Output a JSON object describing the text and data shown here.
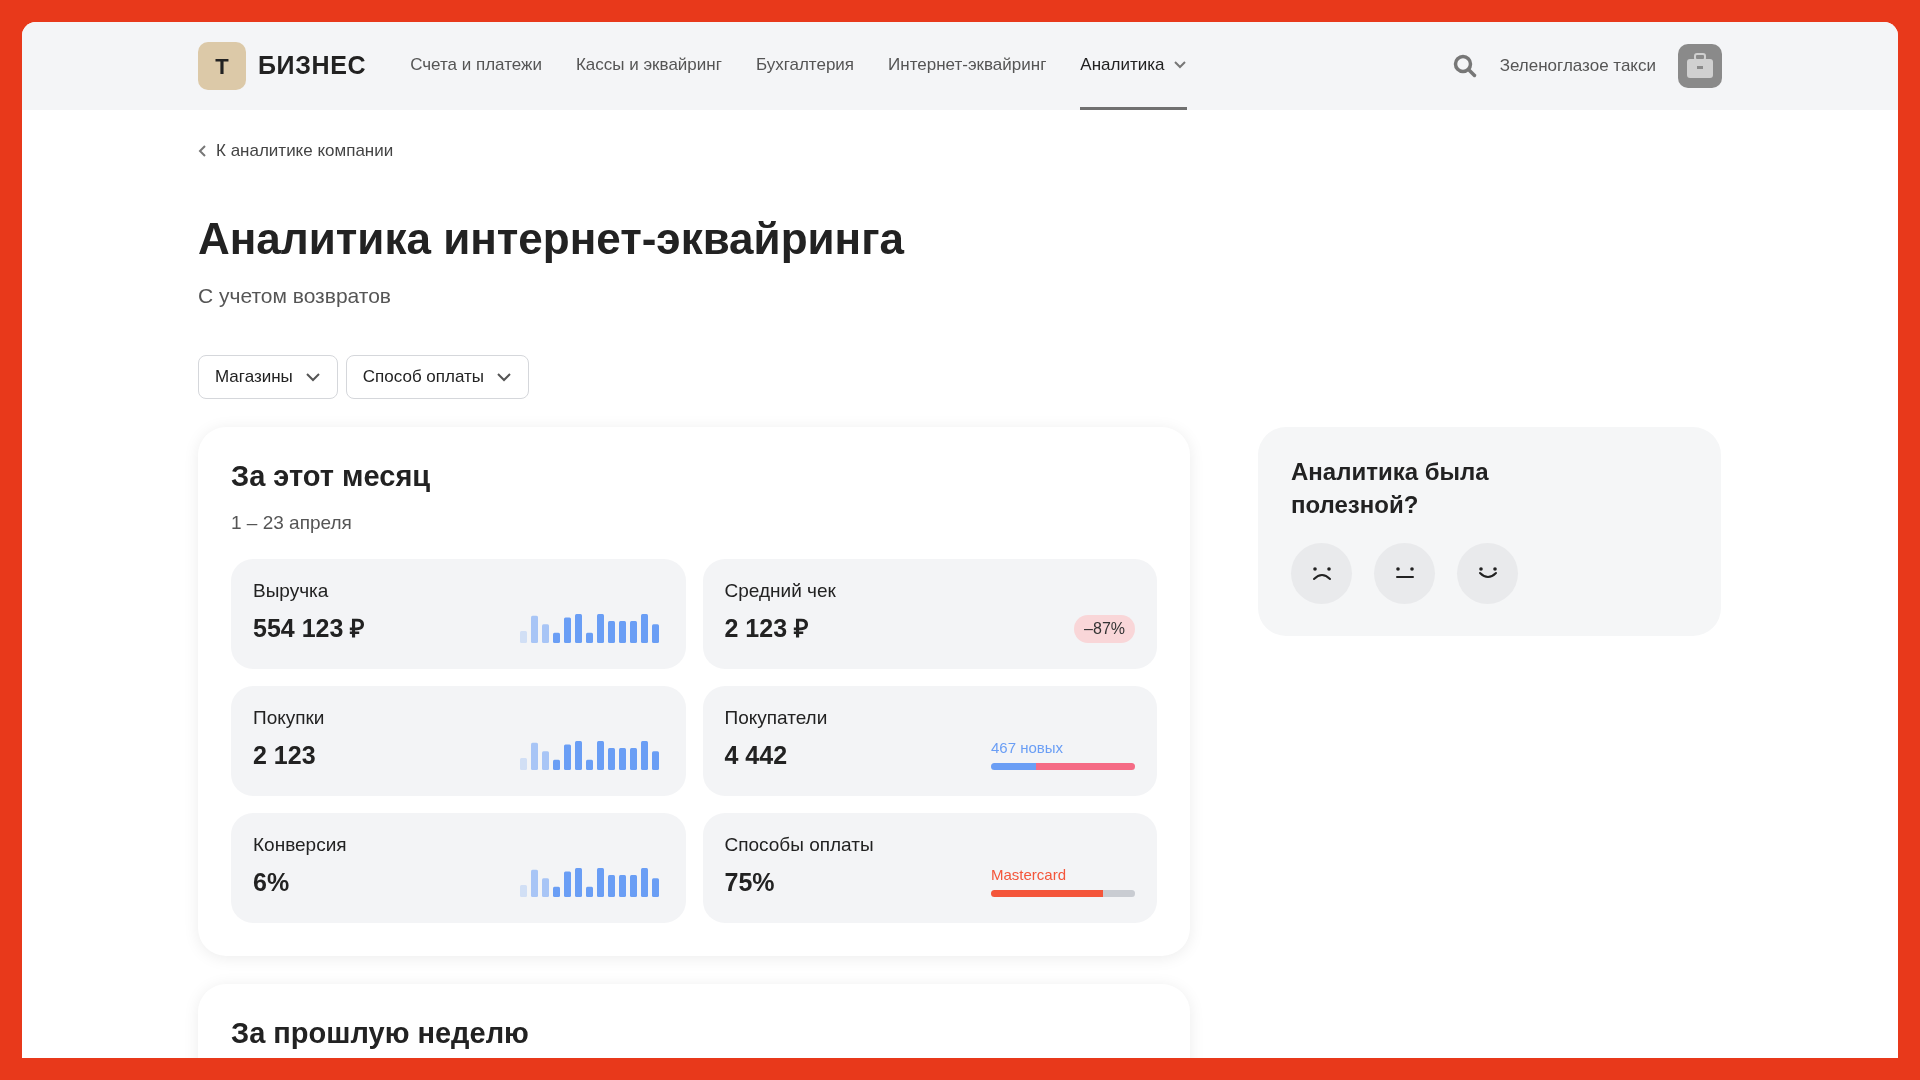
{
  "header": {
    "logo_letter": "Т",
    "logo_text": "БИЗНЕС",
    "nav": [
      {
        "label": "Счета и платежи",
        "selected": false,
        "dropdown": false
      },
      {
        "label": "Кассы и эквайринг",
        "selected": false,
        "dropdown": false
      },
      {
        "label": "Бухгалтерия",
        "selected": false,
        "dropdown": false
      },
      {
        "label": "Интернет-эквайринг",
        "selected": false,
        "dropdown": false
      },
      {
        "label": "Аналитика",
        "selected": true,
        "dropdown": true
      }
    ],
    "company": "Зеленоглазое такси"
  },
  "back_link": "К аналитике компании",
  "title": "Аналитика интернет-эквайринга",
  "subtitle": "С учетом возвратов",
  "filters": [
    "Магазины",
    "Способ оплаты"
  ],
  "month_card": {
    "title": "За этот месяц",
    "period": "1 – 23 апреля",
    "metrics": [
      {
        "kind": "sparkline",
        "label": "Выручка",
        "value": "554 123 ₽"
      },
      {
        "kind": "badge",
        "label": "Средний чек",
        "value": "2 123 ₽",
        "badge": "–87%"
      },
      {
        "kind": "sparkline",
        "label": "Покупки",
        "value": "2 123"
      },
      {
        "kind": "split_bar",
        "label": "Покупатели",
        "value": "4 442",
        "bar_label": "467 новых",
        "segments": [
          {
            "level": 0.31,
            "color": "#6a9ef5"
          },
          {
            "level": 0.69,
            "color": "#f56b85"
          }
        ]
      },
      {
        "kind": "sparkline",
        "label": "Конверсия",
        "value": "6%"
      },
      {
        "kind": "split_bar",
        "label": "Способы оплаты",
        "value": "75%",
        "bar_label": "Mastercard",
        "segments": [
          {
            "level": 0.78,
            "color": "#f4553a"
          },
          {
            "level": 0.22,
            "color": "#c9ccd2"
          }
        ]
      }
    ]
  },
  "week_card": {
    "title": "За прошлую неделю"
  },
  "feedback": {
    "title": "Аналитика была полезной?"
  }
}
